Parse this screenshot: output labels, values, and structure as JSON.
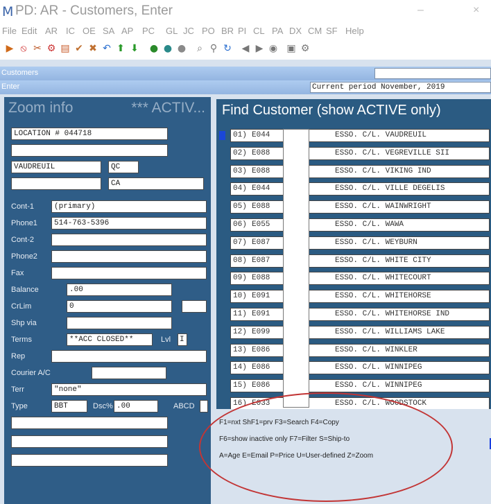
{
  "window": {
    "logo": "M",
    "title": "PD: AR - Customers, Enter",
    "minimize": "–",
    "close": "×"
  },
  "menu": [
    "File",
    "Edit",
    "AR",
    "IC",
    "OE",
    "SA",
    "AP",
    "PC",
    "GL",
    "JC",
    "PO",
    "BR",
    "PI",
    "CL",
    "PA",
    "DX",
    "CM",
    "SF",
    "Help"
  ],
  "toolbar": [
    {
      "icon": "arrow-right-icon",
      "glyph": "▶",
      "color": "#d06a1a"
    },
    {
      "icon": "no-entry-icon",
      "glyph": "⦸",
      "color": "#cc2222"
    },
    {
      "icon": "scissors-icon",
      "glyph": "✂",
      "color": "#bb5522"
    },
    {
      "icon": "gear-icon",
      "glyph": "⚙",
      "color": "#cc3333"
    },
    {
      "icon": "clipboard-icon",
      "glyph": "▤",
      "color": "#c85a2a"
    },
    {
      "icon": "check-icon",
      "glyph": "✔",
      "color": "#c07030"
    },
    {
      "icon": "cross-icon",
      "glyph": "✖",
      "color": "#c07030"
    },
    {
      "icon": "undo-icon",
      "glyph": "↶",
      "color": "#2a6fd0"
    },
    {
      "icon": "arrow-up-icon",
      "glyph": "⬆",
      "color": "#2a9a2a"
    },
    {
      "icon": "arrow-down-icon",
      "glyph": "⬇",
      "color": "#2a9a2a"
    },
    {
      "icon": "circle-green-icon",
      "glyph": "●",
      "color": "#2a8a2a"
    },
    {
      "icon": "circle-teal-icon",
      "glyph": "●",
      "color": "#2a8a8a"
    },
    {
      "icon": "circle-gray-icon",
      "glyph": "●",
      "color": "#8a8a8a"
    },
    {
      "icon": "binoculars-icon",
      "glyph": "⌕",
      "color": "#777"
    },
    {
      "icon": "magnifier-icon",
      "glyph": "⚲",
      "color": "#777"
    },
    {
      "icon": "refresh-icon",
      "glyph": "↻",
      "color": "#2a6fd0"
    },
    {
      "icon": "prev-icon",
      "glyph": "◀",
      "color": "#777"
    },
    {
      "icon": "next-icon",
      "glyph": "▶",
      "color": "#777"
    },
    {
      "icon": "bell-icon",
      "glyph": "◉",
      "color": "#777"
    },
    {
      "icon": "printer-icon",
      "glyph": "▣",
      "color": "#777"
    },
    {
      "icon": "settings-icon",
      "glyph": "⚙",
      "color": "#777"
    }
  ],
  "strip": {
    "module": "Customers",
    "mode": "Enter",
    "period": "Current period  November, 2019"
  },
  "left": {
    "header": "Zoom info",
    "header_status": "*** ACTIV...",
    "address1": "LOCATION # 044718",
    "address2": "",
    "city": "VAUDREUIL",
    "state": "QC",
    "zip": "",
    "country": "CA",
    "labels": {
      "cont1": "Cont-1",
      "phone1": "Phone1",
      "cont2": "Cont-2",
      "phone2": "Phone2",
      "fax": "Fax",
      "balance": "Balance",
      "crlim": "CrLim",
      "shipvia": "Shp via",
      "terms": "Terms",
      "lvl": "Lvl",
      "rep": "Rep",
      "courier": "Courier A/C",
      "terr": "Terr",
      "type": "Type",
      "dsc": "Dsc%",
      "abcd": "ABCD"
    },
    "cont1": "(primary)",
    "phone1": "514-763-5396",
    "cont2": "",
    "phone2": "",
    "fax": "",
    "balance": ".00",
    "crlim": "0",
    "crlim2": "",
    "shipvia": "",
    "terms": "**ACC CLOSED**",
    "lvl": "I",
    "rep": "",
    "courier": "",
    "terr": "\"none\"",
    "type": "BBT",
    "dsc": ".00",
    "abcd": "",
    "extra": [
      "",
      "",
      ""
    ]
  },
  "find": {
    "title": "Find Customer (show ACTIVE only)",
    "rows": [
      {
        "num": "01)",
        "code": "E044",
        "name": "ESSO. C/L. VAUDREUIL"
      },
      {
        "num": "02)",
        "code": "E088",
        "name": "ESSO. C/L. VEGREVILLE SII"
      },
      {
        "num": "03)",
        "code": "E088",
        "name": "ESSO. C/L. VIKING IND"
      },
      {
        "num": "04)",
        "code": "E044",
        "name": "ESSO. C/L. VILLE DEGELIS"
      },
      {
        "num": "05)",
        "code": "E088",
        "name": "ESSO. C/L. WAINWRIGHT"
      },
      {
        "num": "06)",
        "code": "E055",
        "name": "ESSO. C/L. WAWA"
      },
      {
        "num": "07)",
        "code": "E087",
        "name": "ESSO. C/L. WEYBURN"
      },
      {
        "num": "08)",
        "code": "E087",
        "name": "ESSO. C/L. WHITE CITY"
      },
      {
        "num": "09)",
        "code": "E088",
        "name": "ESSO. C/L. WHITECOURT"
      },
      {
        "num": "10)",
        "code": "E091",
        "name": "ESSO. C/L. WHITEHORSE"
      },
      {
        "num": "11)",
        "code": "E091",
        "name": "ESSO. C/L. WHITEHORSE IND"
      },
      {
        "num": "12)",
        "code": "E099",
        "name": "ESSO. C/L. WILLIAMS LAKE"
      },
      {
        "num": "13)",
        "code": "E086",
        "name": "ESSO. C/L. WINKLER"
      },
      {
        "num": "14)",
        "code": "E086",
        "name": "ESSO. C/L. WINNIPEG"
      },
      {
        "num": "15)",
        "code": "E086",
        "name": "ESSO. C/L. WINNIPEG"
      },
      {
        "num": "16)",
        "code": "E033",
        "name": "ESSO. C/L. WOODSTOCK"
      }
    ],
    "fkeys": [
      "F1=nxt ShF1=prv F3=Search F4=Copy",
      "F6=show inactive only F7=Filter S=Ship-to",
      "A=Age E=Email P=Price U=User-defined Z=Zoom"
    ]
  }
}
